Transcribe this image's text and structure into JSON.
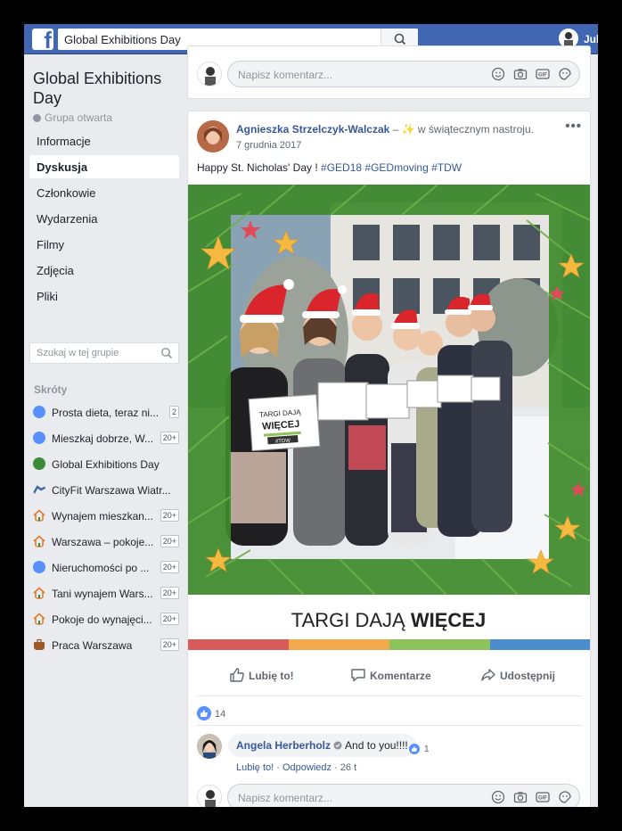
{
  "topbar": {
    "search_value": "Global Exhibitions Day",
    "user_name": "Jul"
  },
  "group": {
    "title": "Global Exhibitions Day",
    "type": "Grupa otwarta",
    "nav": [
      "Informacje",
      "Dyskusja",
      "Członkowie",
      "Wydarzenia",
      "Filmy",
      "Zdjęcia",
      "Pliki"
    ],
    "active_nav": "Dyskusja",
    "search_placeholder": "Szukaj w tej grupie"
  },
  "shortcuts": {
    "title": "Skróty",
    "items": [
      {
        "label": "Prosta dieta, teraz ni...",
        "badge": "2",
        "icon": "group-icon"
      },
      {
        "label": "Mieszkaj dobrze, W...",
        "badge": "20+",
        "icon": "group-icon"
      },
      {
        "label": "Global Exhibitions Day",
        "badge": "",
        "icon": "globe-icon"
      },
      {
        "label": "CityFit Warszawa Wiatr...",
        "badge": "",
        "icon": "runner-icon"
      },
      {
        "label": "Wynajem mieszkan...",
        "badge": "20+",
        "icon": "house-icon"
      },
      {
        "label": "Warszawa – pokoje...",
        "badge": "20+",
        "icon": "house-icon"
      },
      {
        "label": "Nieruchomości po ...",
        "badge": "20+",
        "icon": "group-icon"
      },
      {
        "label": "Tani wynajem Wars...",
        "badge": "20+",
        "icon": "house-icon"
      },
      {
        "label": "Pokoje do wynajęci...",
        "badge": "20+",
        "icon": "house-icon"
      },
      {
        "label": "Praca Warszawa",
        "badge": "20+",
        "icon": "briefcase-icon"
      }
    ]
  },
  "composer": {
    "placeholder": "Napisz komentarz..."
  },
  "post": {
    "author": "Agnieszka Strzelczyk-Walczak",
    "feeling": " – ✨ w świątecznym nastroju.",
    "date": "7 grudnia 2017",
    "text_plain": "Happy St. Nicholas' Day ! ",
    "tags": [
      "#GED18",
      "#GEDmoving",
      "#TDW"
    ],
    "menu": "•••",
    "photo": {
      "banner_text_light": "TARGI DAJĄ ",
      "banner_text_bold": "WIĘCEJ",
      "sign_text_1": "TARGI DAJĄ",
      "sign_text_2": "WIĘCEJ",
      "sign_tag": "#TDW",
      "stripe_colors": [
        "#d85a5a",
        "#f1a94b",
        "#8cc35a",
        "#4a8ccc"
      ]
    },
    "actions": {
      "like": "Lubię to!",
      "comment": "Komentarze",
      "share": "Udostępnij"
    },
    "likes_count": "14"
  },
  "comment": {
    "author": "Angela Herberholz",
    "text": "And to you!!!!",
    "reactions": "1",
    "like_link": "Lubię to!",
    "reply_link": "Odpowiedz",
    "time": "26 t"
  },
  "colors": {
    "brand": "#4267b2",
    "link": "#365899",
    "background": "#e9ebee"
  }
}
